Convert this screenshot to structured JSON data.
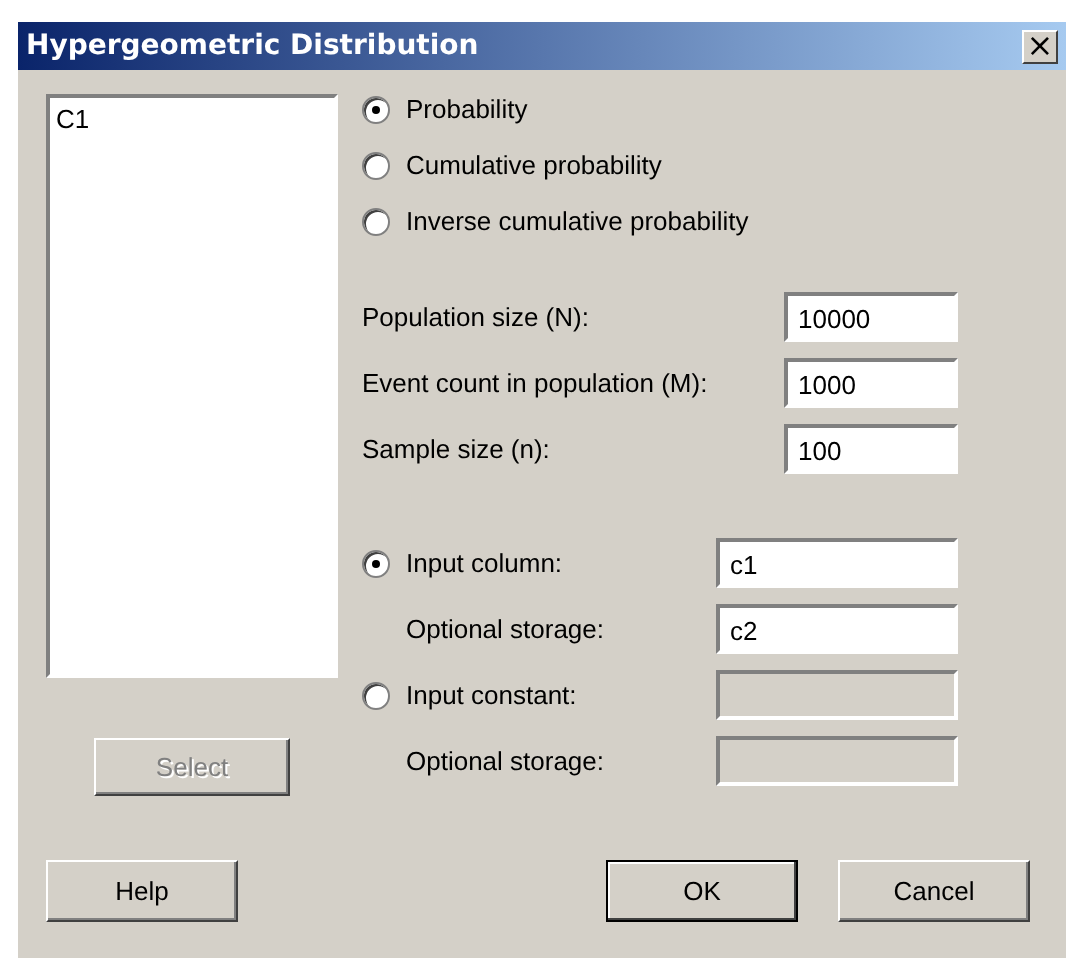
{
  "window": {
    "title": "Hypergeometric Distribution",
    "close_glyph": "×"
  },
  "variables_list": {
    "items": [
      "C1"
    ]
  },
  "select_button": {
    "label": "Select",
    "disabled": true
  },
  "mode_options": [
    {
      "label": "Probability",
      "selected": true
    },
    {
      "label": "Cumulative probability",
      "selected": false
    },
    {
      "label": "Inverse cumulative probability",
      "selected": false
    }
  ],
  "parameters": [
    {
      "label": "Population size (N):",
      "value": "10000"
    },
    {
      "label": "Event count in population (M):",
      "value": "1000"
    },
    {
      "label": "Sample size (n):",
      "value": "100"
    }
  ],
  "input_options": [
    {
      "label": "Input column:",
      "selected": true,
      "disabled": false,
      "value": "c1",
      "storage_label": "Optional storage:",
      "storage_value": "c2"
    },
    {
      "label": "Input constant:",
      "selected": false,
      "disabled": true,
      "storage_label": "Optional storage:"
    }
  ],
  "buttons": [
    {
      "label": "Help",
      "default": false
    },
    {
      "label": "OK",
      "default": true
    },
    {
      "label": "Cancel",
      "default": false
    }
  ]
}
